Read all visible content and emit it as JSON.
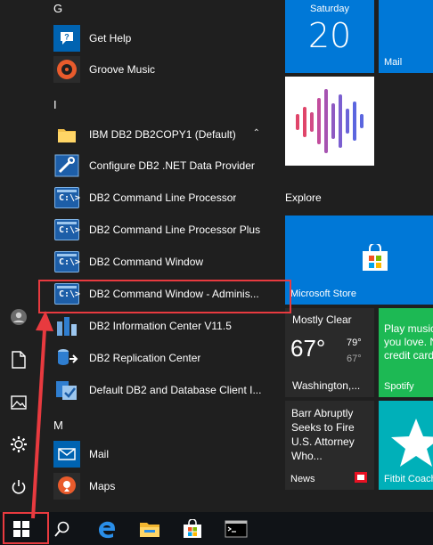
{
  "app_list": {
    "letters": {
      "g": "G",
      "i": "I",
      "m": "M"
    },
    "apps": {
      "get_help": "Get Help",
      "groove_music": "Groove Music",
      "ibm_db2_folder": "IBM DB2 DB2COPY1 (Default)",
      "configure_db2_net": "Configure DB2 .NET Data Provider",
      "db2_clp": "DB2 Command Line Processor",
      "db2_clp_plus": "DB2 Command Line Processor Plus",
      "db2_cmd_window": "DB2 Command Window",
      "db2_cmd_window_admin": "DB2 Command Window - Adminis...",
      "db2_info_center": "DB2 Information Center V11.5",
      "db2_replication": "DB2 Replication Center",
      "default_db2_selection": "Default DB2 and Database Client I...",
      "mail": "Mail",
      "maps": "Maps"
    },
    "c_glyph": "C:\\>"
  },
  "tiles": {
    "calendar": {
      "day": "Saturday",
      "date": "20"
    },
    "mail": {
      "label": "Mail"
    },
    "explore_header": "Explore",
    "store": {
      "label": "Microsoft Store"
    },
    "weather": {
      "condition": "Mostly Clear",
      "temp": "67°",
      "high": "79°",
      "low": "67°",
      "location": "Washington,..."
    },
    "spotify": {
      "text": "Play music you love. No credit cards.",
      "label": "Spotify"
    },
    "news": {
      "headline": "Barr Abruptly Seeks to Fire U.S. Attorney Who...",
      "label": "News"
    },
    "fitbit": {
      "label": "Fitbit Coach"
    }
  },
  "colors": {
    "tile_blue": "#0078d7",
    "spotify_green": "#1db954",
    "fitbit_teal": "#00b0b9",
    "highlight_red": "#e83a3f",
    "background": "#1f1f1f"
  },
  "icons": {
    "rail": [
      "user-icon",
      "document-icon",
      "pictures-icon",
      "settings-icon",
      "power-icon"
    ],
    "taskbar": [
      "windows-start-icon",
      "search-icon",
      "edge-icon",
      "file-explorer-icon",
      "store-icon",
      "command-prompt-icon"
    ]
  }
}
